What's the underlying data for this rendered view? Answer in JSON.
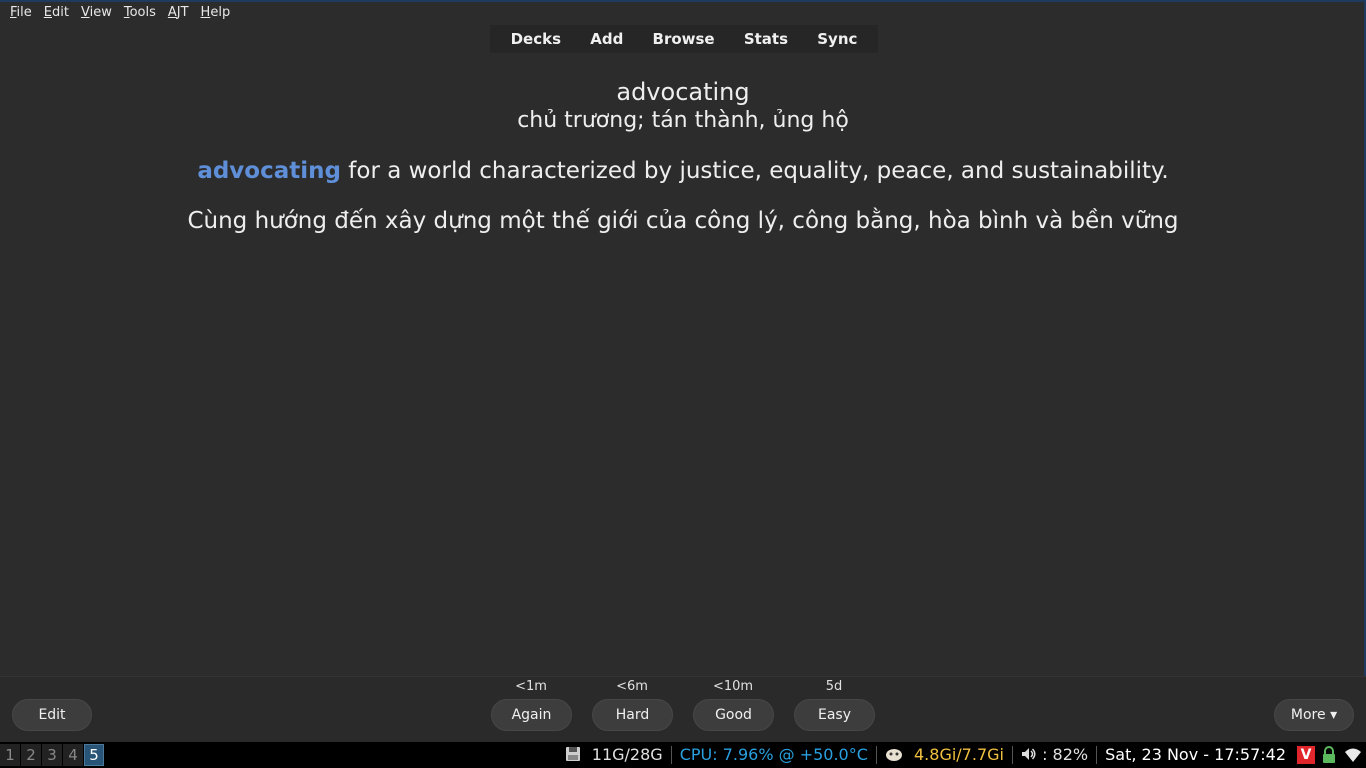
{
  "menu": [
    {
      "key": "F",
      "rest": "ile"
    },
    {
      "key": "E",
      "rest": "dit"
    },
    {
      "key": "V",
      "rest": "iew"
    },
    {
      "key": "T",
      "rest": "ools"
    },
    {
      "key": "A",
      "rest": "JT"
    },
    {
      "key": "H",
      "rest": "elp"
    }
  ],
  "toolbar": {
    "decks": "Decks",
    "add": "Add",
    "browse": "Browse",
    "stats": "Stats",
    "sync": "Sync"
  },
  "card": {
    "word": "advocating",
    "meaning": "chủ trương; tán thành, ủng hộ",
    "example_highlight": "advocating",
    "example_rest": " for a world characterized by justice, equality, peace, and sustainability.",
    "translation": "Cùng hướng đến xây dựng một thế giới của công lý, công bằng, hòa bình và bền vững"
  },
  "review": {
    "edit_label": "Edit",
    "more_label": "More ▾",
    "answers": [
      {
        "interval": "<1m",
        "label": "Again"
      },
      {
        "interval": "<6m",
        "label": "Hard"
      },
      {
        "interval": "<10m",
        "label": "Good"
      },
      {
        "interval": "5d",
        "label": "Easy"
      }
    ]
  },
  "taskbar": {
    "workspaces": [
      "1",
      "2",
      "3",
      "4",
      "5"
    ],
    "active_workspace": "5",
    "disk": "11G/28G",
    "cpu": "CPU:  7.96% @ +50.0°C",
    "memory": "4.8Gi/7.7Gi",
    "volume": ": 82%",
    "clock": "Sat, 23 Nov - 17:57:42",
    "vivaldi_letter": "V"
  },
  "colors": {
    "background": "#2c2c2c",
    "highlight": "#5f8fd8",
    "cpu": "#2aa0e0",
    "memory": "#f0c040",
    "workspace_active": "#285577"
  }
}
